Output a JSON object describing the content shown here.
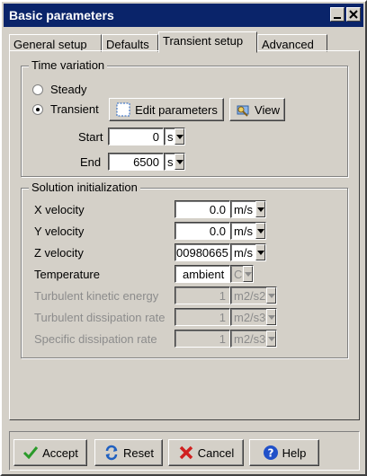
{
  "window": {
    "title": "Basic parameters"
  },
  "tabs": [
    {
      "label": "General setup"
    },
    {
      "label": "Defaults"
    },
    {
      "label": "Transient setup"
    },
    {
      "label": "Advanced"
    }
  ],
  "time_variation": {
    "legend": "Time variation",
    "steady_label": "Steady",
    "transient_label": "Transient",
    "selected": "Transient",
    "edit_parameters_label": "Edit parameters",
    "view_label": "View",
    "start_label": "Start",
    "start_value": "0",
    "start_unit": "s",
    "end_label": "End",
    "end_value": "6500",
    "end_unit": "s"
  },
  "solution_init": {
    "legend": "Solution initialization",
    "rows": [
      {
        "label": "X velocity",
        "value": "0.0",
        "unit": "m/s",
        "enabled": true
      },
      {
        "label": "Y velocity",
        "value": "0.0",
        "unit": "m/s",
        "enabled": true
      },
      {
        "label": "Z velocity",
        "value": "00980665",
        "unit": "m/s",
        "enabled": true
      },
      {
        "label": "Temperature",
        "value": "ambient",
        "unit": "C",
        "enabled": true
      },
      {
        "label": "Turbulent kinetic energy",
        "value": "1",
        "unit": "m2/s2",
        "enabled": false
      },
      {
        "label": "Turbulent dissipation rate",
        "value": "1",
        "unit": "m2/s3",
        "enabled": false
      },
      {
        "label": "Specific dissipation rate",
        "value": "1",
        "unit": "m2/s3",
        "enabled": false
      }
    ]
  },
  "buttons": {
    "accept": "Accept",
    "reset": "Reset",
    "cancel": "Cancel",
    "help": "Help"
  },
  "colors": {
    "titlebar": "#0a246a",
    "face": "#d4d0c8",
    "disabled_text": "#8c8c8c"
  }
}
